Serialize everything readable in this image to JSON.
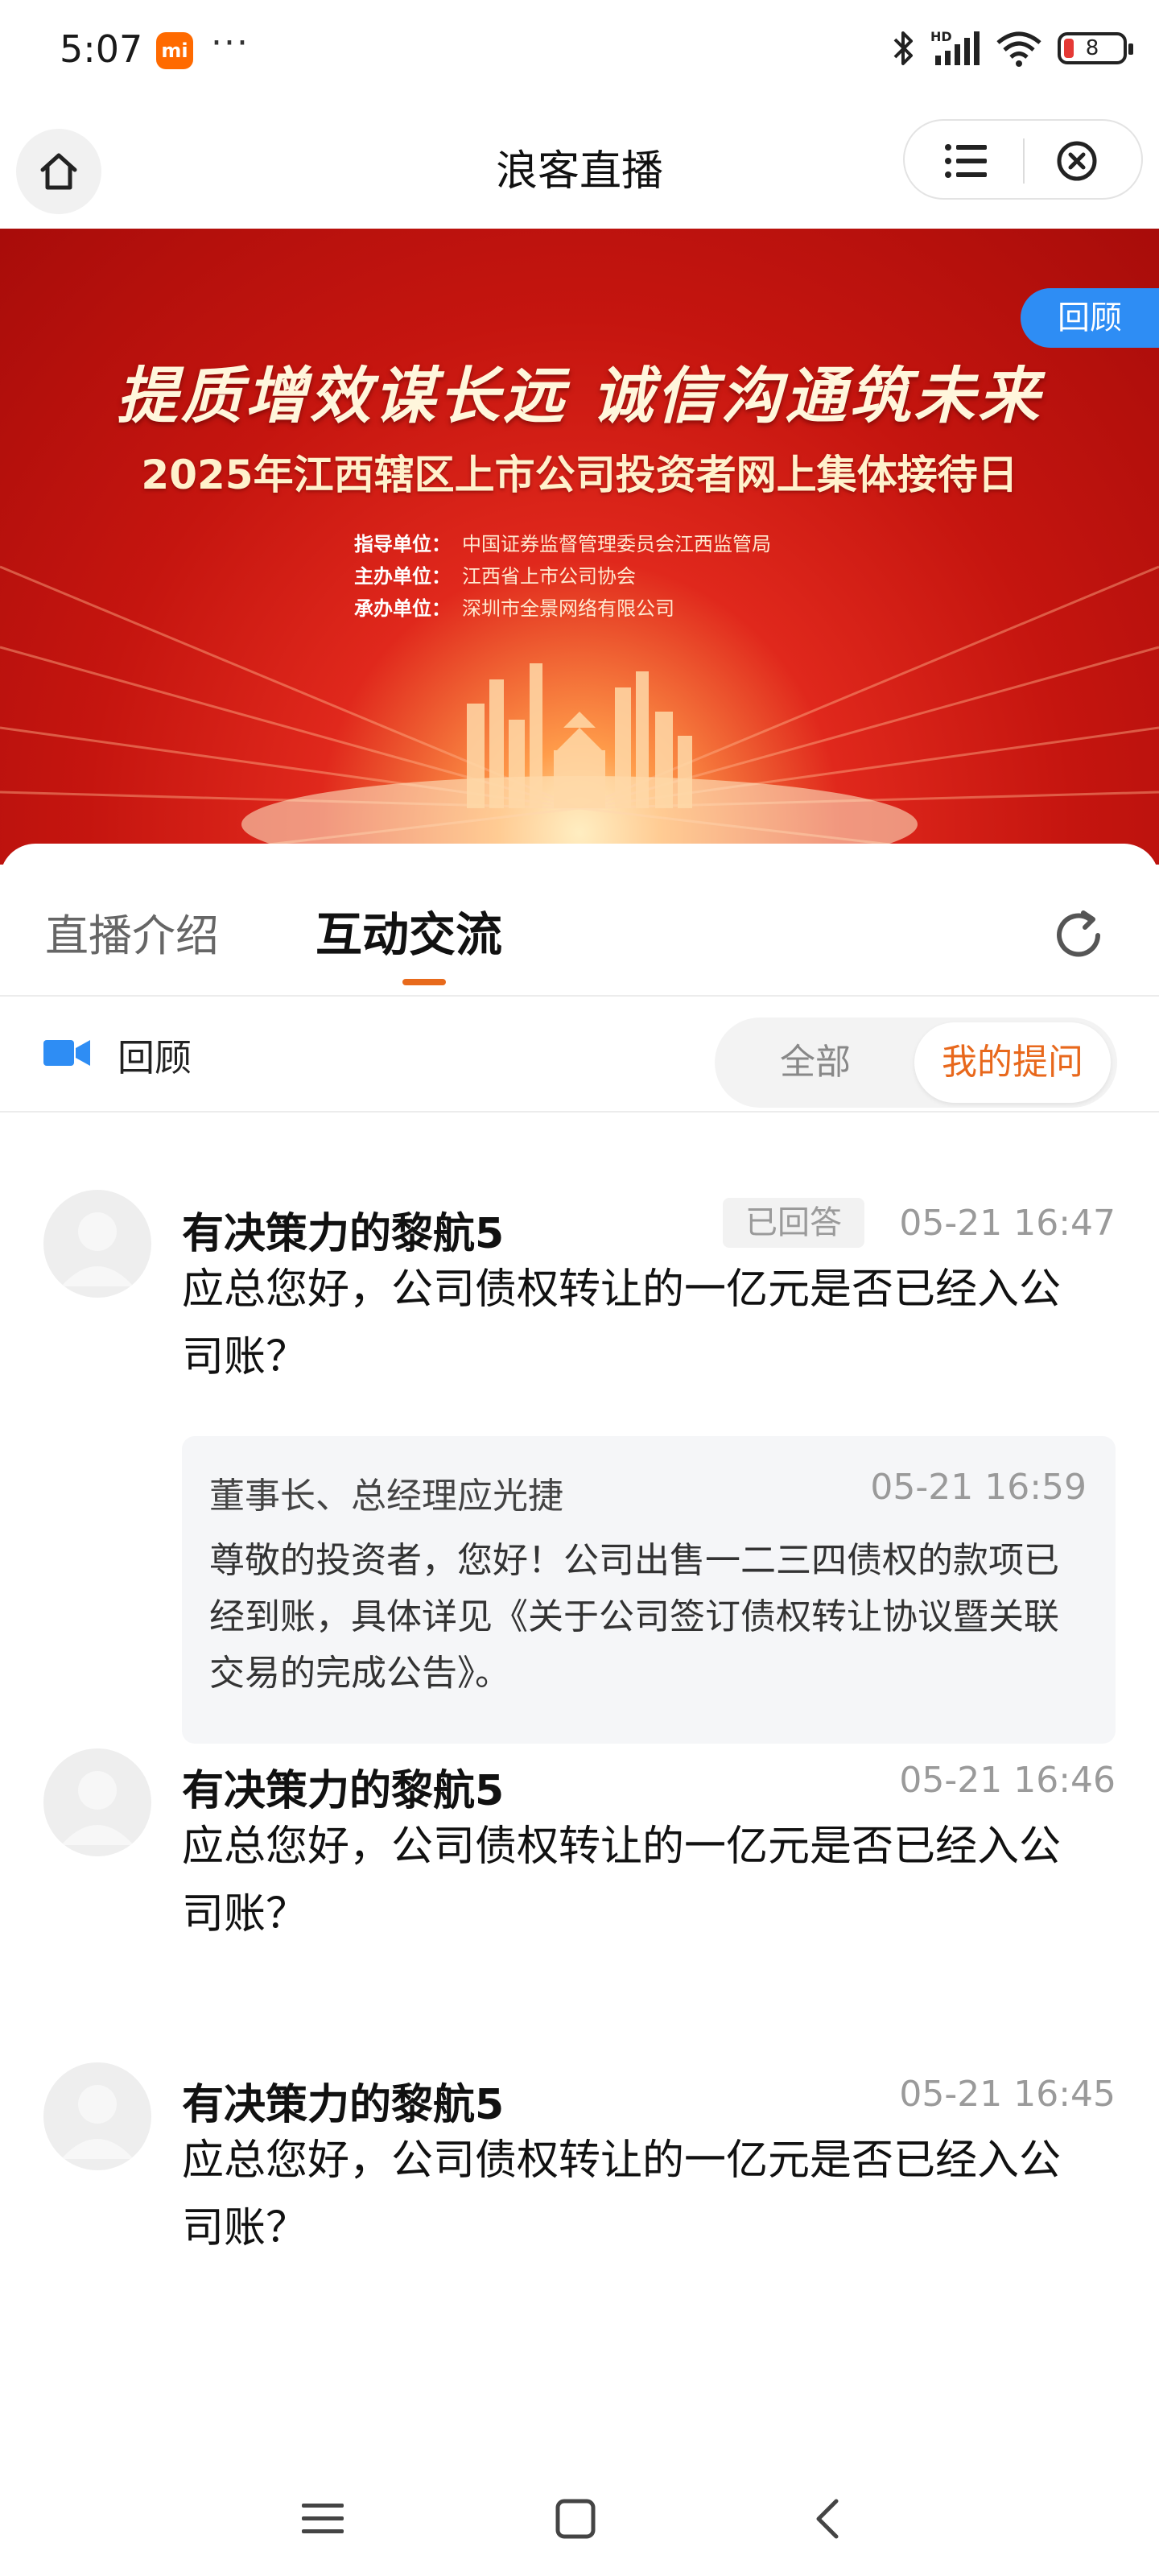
{
  "status_bar": {
    "time": "5:07",
    "mi_label": "mi",
    "dots": "···",
    "hd_label": "HD",
    "battery": "8"
  },
  "header": {
    "title": "浪客直播"
  },
  "banner": {
    "replay_badge": "回顾",
    "slogan": "提质增效谋长远  诚信沟通筑未来",
    "event_title": "2025年江西辖区上市公司投资者网上集体接待日",
    "orgs": [
      {
        "role": "指导单位：",
        "name": "中国证券监督管理委员会江西监管局"
      },
      {
        "role": "主办单位：",
        "name": "江西省上市公司协会"
      },
      {
        "role": "承办单位：",
        "name": "深圳市全景网络有限公司"
      }
    ]
  },
  "tabs": {
    "intro": "直播介绍",
    "chat": "互动交流"
  },
  "subbar": {
    "label": "回顾",
    "filter_all": "全部",
    "filter_mine": "我的提问"
  },
  "questions": [
    {
      "user": "有决策力的黎航5",
      "badge": "已回答",
      "time": "05-21 16:47",
      "text": "应总您好，公司债权转让的一亿元是否已经入公司账？",
      "answer": {
        "name": "董事长、总经理应光捷",
        "time": "05-21 16:59",
        "text": "尊敬的投资者，您好！公司出售一二三四债权的款项已经到账，具体详见《关于公司签订债权转让协议暨关联交易的完成公告》。"
      }
    },
    {
      "user": "有决策力的黎航5",
      "time": "05-21 16:46",
      "text": "应总您好，公司债权转让的一亿元是否已经入公司账？"
    },
    {
      "user": "有决策力的黎航5",
      "time": "05-21 16:45",
      "text": "应总您好，公司债权转让的一亿元是否已经入公司账？"
    }
  ],
  "colors": {
    "accent": "#e8681c",
    "badge_blue": "#2e8df4",
    "banner_red": "#c5150f"
  },
  "icons": {
    "home": "home-icon",
    "menu": "list-menu-icon",
    "close": "circle-close-icon",
    "refresh": "refresh-icon",
    "camera": "video-camera-icon"
  }
}
